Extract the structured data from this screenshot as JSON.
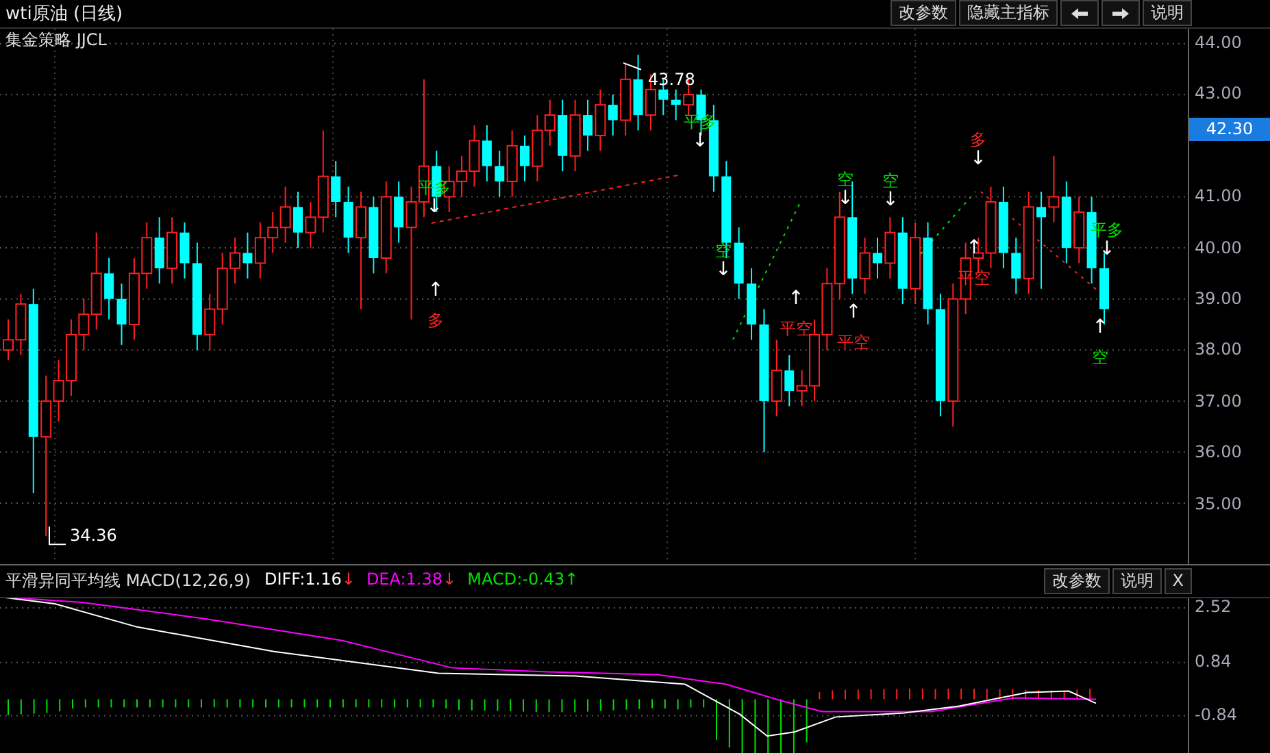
{
  "window": {
    "title": "wti原油 (日线)"
  },
  "toolbar": {
    "buttons": [
      "改参数",
      "隐藏主指标",
      "说明"
    ]
  },
  "main_chart": {
    "indicator_name": "集金策略 JJCL",
    "last_price": "42.30",
    "high_label": "43.78",
    "low_label": "34.36",
    "chart_data": {
      "type": "candlestick",
      "ylim": [
        33.82,
        44.29
      ],
      "grid": true,
      "ohlc": [
        [
          38.0,
          38.6,
          37.8,
          38.2
        ],
        [
          38.2,
          39.1,
          37.9,
          38.9
        ],
        [
          38.9,
          39.2,
          35.2,
          36.3
        ],
        [
          36.3,
          37.5,
          34.36,
          37.0
        ],
        [
          37.0,
          37.8,
          36.6,
          37.4
        ],
        [
          37.4,
          38.6,
          37.1,
          38.3
        ],
        [
          38.3,
          39.0,
          38.0,
          38.7
        ],
        [
          38.7,
          40.3,
          38.4,
          39.5
        ],
        [
          39.5,
          39.8,
          38.6,
          39.0
        ],
        [
          39.0,
          39.3,
          38.1,
          38.5
        ],
        [
          38.5,
          39.8,
          38.2,
          39.5
        ],
        [
          39.5,
          40.5,
          39.2,
          40.2
        ],
        [
          40.2,
          40.6,
          39.3,
          39.6
        ],
        [
          39.6,
          40.6,
          39.3,
          40.3
        ],
        [
          40.3,
          40.5,
          39.4,
          39.7
        ],
        [
          39.7,
          40.1,
          38.0,
          38.3
        ],
        [
          38.3,
          39.1,
          38.0,
          38.8
        ],
        [
          38.8,
          39.9,
          38.5,
          39.6
        ],
        [
          39.6,
          40.2,
          39.3,
          39.9
        ],
        [
          39.9,
          40.3,
          39.4,
          39.7
        ],
        [
          39.7,
          40.5,
          39.4,
          40.2
        ],
        [
          40.2,
          40.7,
          39.9,
          40.4
        ],
        [
          40.4,
          41.2,
          40.1,
          40.8
        ],
        [
          40.8,
          41.1,
          40.0,
          40.3
        ],
        [
          40.3,
          40.9,
          40.0,
          40.6
        ],
        [
          40.6,
          42.3,
          40.3,
          41.4
        ],
        [
          41.4,
          41.7,
          40.6,
          40.9
        ],
        [
          40.9,
          41.2,
          39.9,
          40.2
        ],
        [
          40.2,
          41.1,
          38.8,
          40.8
        ],
        [
          40.8,
          41.0,
          39.5,
          39.8
        ],
        [
          39.8,
          41.3,
          39.5,
          41.0
        ],
        [
          41.0,
          41.3,
          40.1,
          40.4
        ],
        [
          40.4,
          41.2,
          38.6,
          40.9
        ],
        [
          40.9,
          43.3,
          40.6,
          41.6
        ],
        [
          41.6,
          41.9,
          40.7,
          41.0
        ],
        [
          41.0,
          41.6,
          40.7,
          41.3
        ],
        [
          41.3,
          41.8,
          41.0,
          41.5
        ],
        [
          41.5,
          42.4,
          41.2,
          42.1
        ],
        [
          42.1,
          42.4,
          41.3,
          41.6
        ],
        [
          41.6,
          41.9,
          41.0,
          41.3
        ],
        [
          41.3,
          42.3,
          41.0,
          42.0
        ],
        [
          42.0,
          42.2,
          41.3,
          41.6
        ],
        [
          41.6,
          42.6,
          41.3,
          42.3
        ],
        [
          42.3,
          42.9,
          42.0,
          42.6
        ],
        [
          42.6,
          42.9,
          41.5,
          41.8
        ],
        [
          41.8,
          42.9,
          41.5,
          42.6
        ],
        [
          42.6,
          42.9,
          41.9,
          42.2
        ],
        [
          42.2,
          43.1,
          41.9,
          42.8
        ],
        [
          42.8,
          43.0,
          42.2,
          42.5
        ],
        [
          42.5,
          43.6,
          42.2,
          43.3
        ],
        [
          43.3,
          43.78,
          42.3,
          42.6
        ],
        [
          42.6,
          43.4,
          42.3,
          43.1
        ],
        [
          43.1,
          43.3,
          42.6,
          42.9
        ],
        [
          42.9,
          43.1,
          42.5,
          42.8
        ],
        [
          42.8,
          43.3,
          42.6,
          43.0
        ],
        [
          43.0,
          43.1,
          42.2,
          42.5
        ],
        [
          42.5,
          42.8,
          41.1,
          41.4
        ],
        [
          41.4,
          41.7,
          39.8,
          40.1
        ],
        [
          40.1,
          40.4,
          39.0,
          39.3
        ],
        [
          39.3,
          39.6,
          38.2,
          38.5
        ],
        [
          38.5,
          38.8,
          36.0,
          37.0
        ],
        [
          37.0,
          38.2,
          36.7,
          37.6
        ],
        [
          37.6,
          37.9,
          36.9,
          37.2
        ],
        [
          37.2,
          37.6,
          36.9,
          37.3
        ],
        [
          37.3,
          38.6,
          37.0,
          38.3
        ],
        [
          38.3,
          39.6,
          38.0,
          39.3
        ],
        [
          39.3,
          41.1,
          39.0,
          40.6
        ],
        [
          40.6,
          41.3,
          39.1,
          39.4
        ],
        [
          39.4,
          40.2,
          39.1,
          39.9
        ],
        [
          39.9,
          40.2,
          39.4,
          39.7
        ],
        [
          39.7,
          40.6,
          39.4,
          40.3
        ],
        [
          40.3,
          40.6,
          38.9,
          39.2
        ],
        [
          39.2,
          40.5,
          38.9,
          40.2
        ],
        [
          40.2,
          40.5,
          38.5,
          38.8
        ],
        [
          38.8,
          39.1,
          36.7,
          37.0
        ],
        [
          37.0,
          39.3,
          36.5,
          39.0
        ],
        [
          39.0,
          40.1,
          38.7,
          39.8
        ],
        [
          39.8,
          40.2,
          39.5,
          39.9
        ],
        [
          39.9,
          41.2,
          39.6,
          40.9
        ],
        [
          40.9,
          41.2,
          39.6,
          39.9
        ],
        [
          39.9,
          40.2,
          39.1,
          39.4
        ],
        [
          39.4,
          41.1,
          39.1,
          40.8
        ],
        [
          40.8,
          41.1,
          39.2,
          40.6
        ],
        [
          40.8,
          41.8,
          40.5,
          41.0
        ],
        [
          41.0,
          41.3,
          39.7,
          40.0
        ],
        [
          40.0,
          41.0,
          39.7,
          40.7
        ],
        [
          40.7,
          41.0,
          39.3,
          39.6
        ],
        [
          39.6,
          39.9,
          38.5,
          38.8
        ]
      ],
      "yticks": [
        {
          "value": 44,
          "label": "44.00"
        },
        {
          "value": 43,
          "label": "43.00"
        },
        {
          "value": 41,
          "label": "41.00"
        },
        {
          "value": 40,
          "label": "40.00"
        },
        {
          "value": 39,
          "label": "39.00"
        },
        {
          "value": 38,
          "label": "38.00"
        },
        {
          "value": 37,
          "label": "37.00"
        },
        {
          "value": 36,
          "label": "36.00"
        },
        {
          "value": 35,
          "label": "35.00"
        }
      ]
    },
    "signals": [
      {
        "label": "平多",
        "color": "#00e000",
        "arrow": "↓"
      },
      {
        "label": "多",
        "color": "#ff2020",
        "arrow": "↑"
      },
      {
        "label": "平多",
        "color": "#00e000",
        "arrow": "↓"
      },
      {
        "label": "空",
        "color": "#00e000",
        "arrow": "↓"
      },
      {
        "label": "平空",
        "color": "#ff2020",
        "arrow": "↑"
      },
      {
        "label": "空",
        "color": "#00e000",
        "arrow": "↓"
      },
      {
        "label": "平空",
        "color": "#ff2020",
        "arrow": "↑"
      },
      {
        "label": "空",
        "color": "#00e000",
        "arrow": "↓"
      },
      {
        "label": "多",
        "color": "#ff2020",
        "arrow": "↓"
      },
      {
        "label": "平空",
        "color": "#ff2020",
        "arrow": "↑"
      },
      {
        "label": "平多",
        "color": "#00e000",
        "arrow": "↓"
      },
      {
        "label": "空",
        "color": "#00e000",
        "arrow": "↑"
      }
    ]
  },
  "macd_panel": {
    "title": "平滑异同平均线 MACD(12,26,9)",
    "values": [
      {
        "text": "DIFF:1.16",
        "arrow": "↓",
        "color": "#ffffff"
      },
      {
        "text": "DEA:1.38",
        "arrow": "↓",
        "color": "#ff00ff"
      },
      {
        "text": "MACD:-0.43",
        "arrow": "↑",
        "color": "#00e000"
      }
    ],
    "buttons": [
      "改参数",
      "说明",
      "X"
    ],
    "y_ticks": [
      "2.52",
      "0.84",
      "-0.84"
    ]
  }
}
